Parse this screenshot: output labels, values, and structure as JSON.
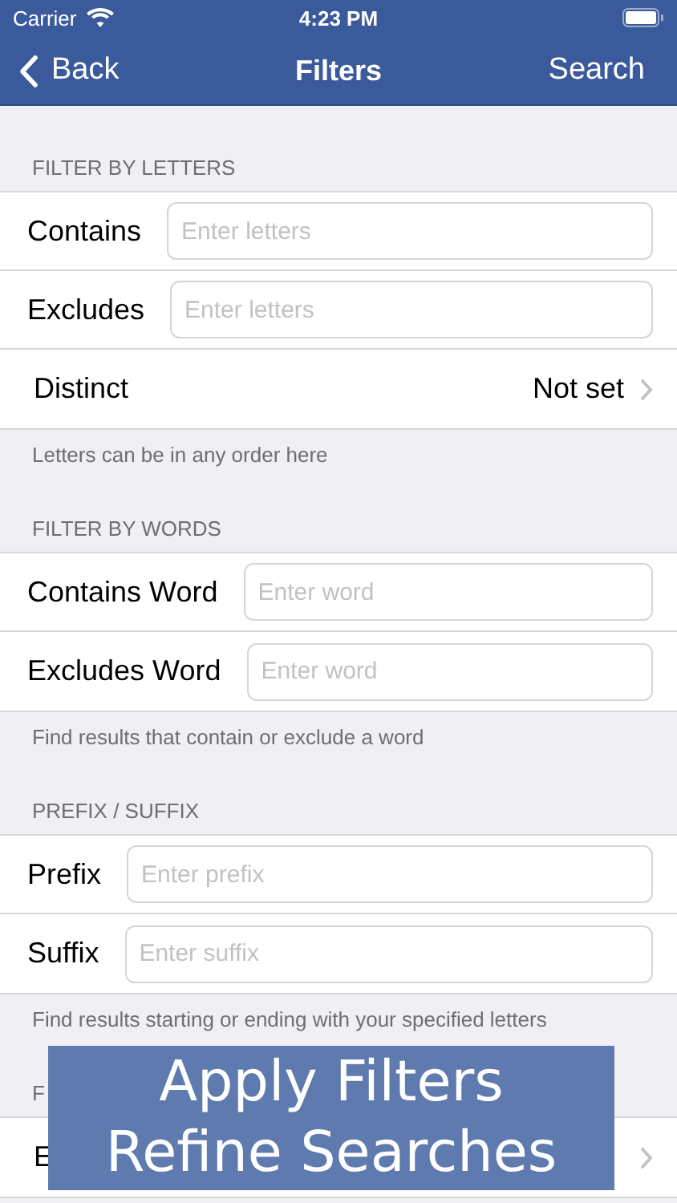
{
  "status_bar": {
    "carrier": "Carrier",
    "time": "4:23 PM"
  },
  "nav": {
    "back": "Back",
    "title": "Filters",
    "action": "Search"
  },
  "sections": [
    {
      "header": "FILTER BY LETTERS",
      "rows": [
        {
          "kind": "field",
          "label": "Contains",
          "placeholder": "Enter letters"
        },
        {
          "kind": "field",
          "label": "Excludes",
          "placeholder": "Enter letters"
        },
        {
          "kind": "choice",
          "label": "Distinct",
          "value": "Not set"
        }
      ],
      "footer": "Letters can be in any order here"
    },
    {
      "header": "FILTER BY WORDS",
      "rows": [
        {
          "kind": "field",
          "label": "Contains Word",
          "placeholder": "Enter word"
        },
        {
          "kind": "field",
          "label": "Excludes Word",
          "placeholder": "Enter word"
        }
      ],
      "footer": "Find results that contain or exclude a word"
    },
    {
      "header": "PREFIX / SUFFIX",
      "rows": [
        {
          "kind": "field",
          "label": "Prefix",
          "placeholder": "Enter prefix"
        },
        {
          "kind": "field",
          "label": "Suffix",
          "placeholder": "Enter suffix"
        }
      ],
      "footer": "Find results starting or ending with your specified letters"
    },
    {
      "header": "F",
      "rows": [
        {
          "kind": "choice",
          "label": "E"
        }
      ]
    }
  ],
  "banner": [
    "Apply Filters",
    "Refine Searches"
  ]
}
